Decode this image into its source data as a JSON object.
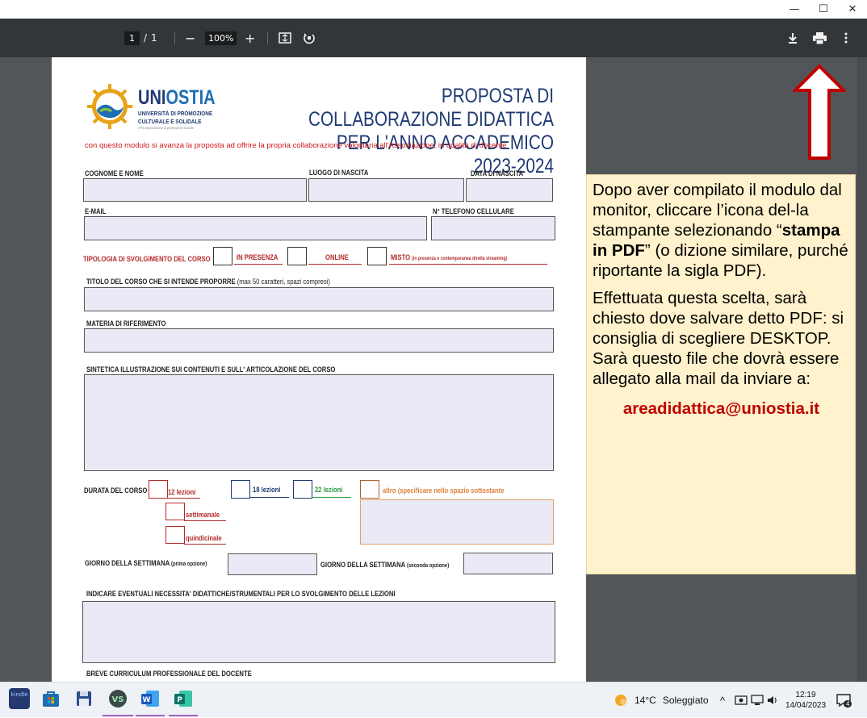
{
  "window": {
    "minimize": "—",
    "maximize": "☐",
    "close": "✕"
  },
  "toolbar": {
    "page_current": "1",
    "page_sep": "/",
    "page_total": "1",
    "zoom_out": "−",
    "zoom_level": "100%",
    "zoom_in": "+",
    "download_icon": "download-icon",
    "print_icon": "print-icon",
    "more_icon": "more-vert-icon"
  },
  "doc": {
    "brand_uni": "UNI",
    "brand_ostia": "OSTIA",
    "brand_sub1": "UNIVERSITÀ DI PROMOZIONE",
    "brand_sub2": "CULTURALE E SOLIDALE",
    "brand_sub3": "APS associazione di promozione sociale",
    "title1": "PROPOSTA DI COLLABORAZIONE DIDATTICA",
    "title2": "PER L'ANNO ACCADEMICO 2023-2024",
    "intro": "con questo modulo si avanza la proposta ad offrire la propria collaborazione volontaria all'Associazione, in qualità di docente",
    "lbl_nome": "COGNOME E NOME",
    "lbl_luogo": "LUOGO DI NASCITA",
    "lbl_data": "DATA DI NASCITA",
    "lbl_email": "E-MAIL",
    "lbl_tel": "N° TELEFONO CELLULARE",
    "lbl_tipologia": "TIPOLOGIA DI SVOLGIMENTO DEL CORSO",
    "opt_presenza": "IN PRESENZA",
    "opt_online": "ONLINE",
    "opt_misto": "MISTO",
    "opt_misto_sub": "(in presenza e contemporanea diretta streaming)",
    "lbl_titolo": "TITOLO DEL CORSO CHE SI INTENDE PROPORRE",
    "lbl_titolo_sub": "(max 50 caratteri, spazi compresi)",
    "lbl_materia": "MATERIA DI RIFERIMENTO",
    "lbl_sintetica": "SINTETICA ILLUSTRAZIONE SUI CONTENUTI E SULL' ARTICOLAZIONE DEL CORSO",
    "lbl_durata": "DURATA DEL CORSO",
    "opt_12": "12 lezioni",
    "opt_18": "18 lezioni",
    "opt_22": "22 lezioni",
    "opt_altro": "altro (specificare nello spazio sottostante",
    "opt_settimanale": "settimanale",
    "opt_quindicinale": "quindicinale",
    "lbl_giorno1": "GIORNO DELLA SETTIMANA",
    "lbl_giorno1_sub": "(prima opzione)",
    "lbl_giorno2": "GIORNO DELLA SETTIMANA",
    "lbl_giorno2_sub": "(seconda opzione)",
    "lbl_necessita": "INDICARE EVENTUALI NECESSITA' DIDATTICHE/STRUMENTALI PER LO SVOLGIMENTO DELLE LEZIONI",
    "lbl_curriculum": "BREVE CURRICULUM PROFESSIONALE DEL DOCENTE"
  },
  "note": {
    "p1_a": "Dopo aver compilato il modulo dal monitor, cliccare l’icona del-la stampante selezionando “",
    "p1_bold": "stampa in PDF",
    "p1_b": "” (o dizione similare, purché riportante la sigla PDF).",
    "p2": "Effettuata questa scelta, sarà chiesto dove salvare detto PDF: si consiglia di scegliere DESKTOP. Sarà questo file che dovrà essere allegato alla mail da inviare a:",
    "email": "areadidattica@uniostia.it"
  },
  "taskbar": {
    "weather_temp": "14°C",
    "weather_desc": "Soleggiato",
    "time": "12:19",
    "date": "14/04/2023",
    "notif_count": "4",
    "chevron": "^",
    "kindle": "kindle"
  },
  "colors": {
    "toolbar": "#323639",
    "viewer_bg": "#525659",
    "note_bg": "#fff2cc",
    "arrow": "#c00000",
    "form_red": "#b22a2a",
    "form_blue": "#1f3a73"
  }
}
